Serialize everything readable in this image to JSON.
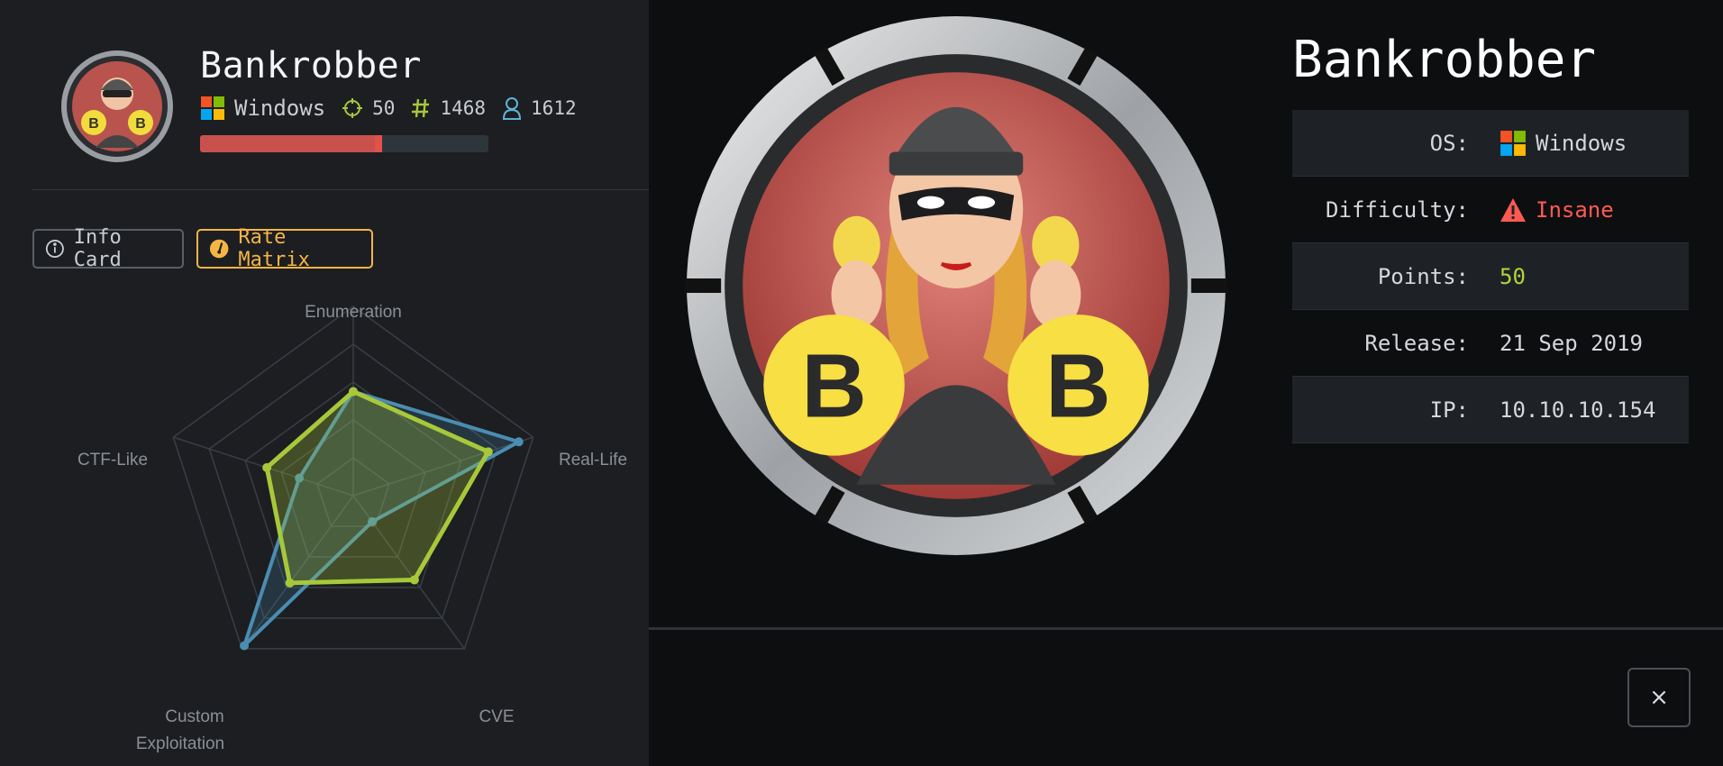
{
  "machine": {
    "name": "Bankrobber",
    "os": "Windows",
    "points": "50",
    "user_owns": "1468",
    "system_owns": "1612",
    "progress_fraction": 0.63
  },
  "tabs": {
    "info_card": "Info Card",
    "rate_matrix": "Rate Matrix"
  },
  "radar": {
    "axes": [
      "Enumeration",
      "Real-Life",
      "CVE",
      "Custom Exploitation",
      "CTF-Like"
    ],
    "labels": {
      "enumeration": "Enumeration",
      "real_life": "Real-Life",
      "cve": "CVE",
      "custom_line1": "Custom",
      "custom_line2": "Exploitation",
      "ctf_like": "CTF-Like"
    },
    "series": [
      {
        "values": [
          0.55,
          0.92,
          0.17,
          0.98,
          0.3
        ],
        "color": "#4a8db3"
      },
      {
        "values": [
          0.55,
          0.75,
          0.55,
          0.57,
          0.48
        ],
        "color": "#a8c83a"
      }
    ]
  },
  "details": {
    "title": "Bankrobber",
    "os_label": "OS:",
    "os_value": "Windows",
    "difficulty_label": "Difficulty:",
    "difficulty_value": "Insane",
    "points_label": "Points:",
    "points_value": "50",
    "release_label": "Release:",
    "release_value": "21 Sep 2019",
    "ip_label": "IP:",
    "ip_value": "10.10.10.154"
  },
  "close_label": "×",
  "colors": {
    "accent_orange": "#f5b544",
    "difficulty_red": "#ff5a52",
    "points_green": "#b4d33a",
    "progress_red": "#c9514d"
  }
}
